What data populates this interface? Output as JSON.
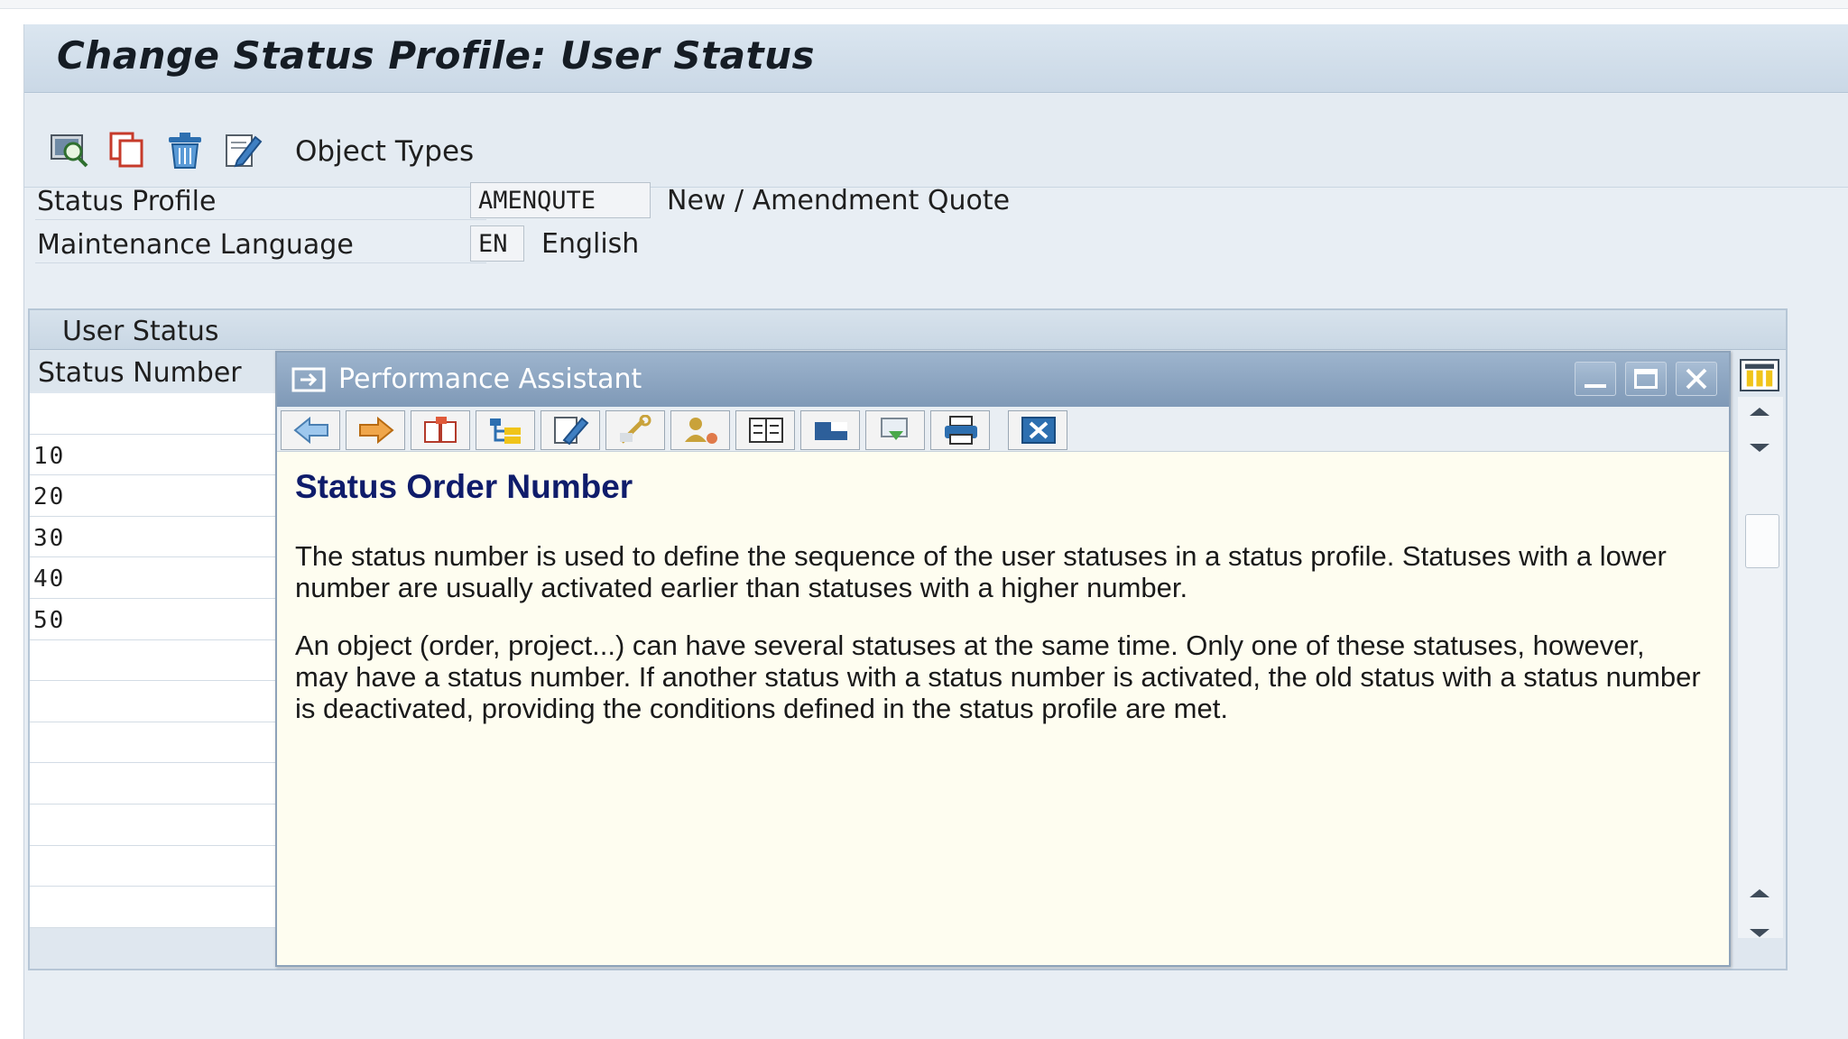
{
  "window": {
    "title": "Change Status Profile: User Status"
  },
  "toolbar": {
    "icons": [
      "find-icon",
      "copy-icon",
      "delete-icon",
      "edit-icon"
    ],
    "object_types_label": "Object Types"
  },
  "header": {
    "status_profile": {
      "label": "Status Profile",
      "code": "AMENQUTE",
      "description": "New / Amendment Quote"
    },
    "language": {
      "label": "Maintenance Language",
      "code": "EN",
      "description": "English"
    }
  },
  "table": {
    "title": "User Status",
    "column_header": "Status Number",
    "rows": [
      "",
      "10",
      "20",
      "30",
      "40",
      "50",
      "",
      "",
      "",
      "",
      "",
      "",
      ""
    ]
  },
  "dialog": {
    "title": "Performance Assistant",
    "heading": "Status Order Number",
    "paragraphs": [
      "The status number is used to define the sequence of the user statuses in a status profile.  Statuses with a lower number are usually activated earlier than statuses with a higher number.",
      "An object (order, project...) can have several statuses at the same time. Only one of these statuses, however, may have a status number. If another status with a status number is activated, the old status with a status number is deactivated, providing the conditions defined in the status profile are met."
    ],
    "tools": [
      "back-icon",
      "forward-icon",
      "book-icon",
      "structure-icon",
      "edit-note-icon",
      "technical-info-icon",
      "user-icon",
      "document-icon",
      "link-icon",
      "save-icon",
      "print-icon",
      "close-icon"
    ]
  }
}
